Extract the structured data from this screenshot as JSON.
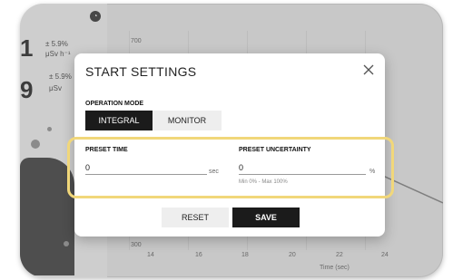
{
  "background": {
    "reading_1": {
      "value": "1",
      "percent": "± 5.9%",
      "unit": "μSv h⁻¹"
    },
    "reading_2": {
      "value": "9",
      "percent": "± 5.9%",
      "unit": "μSv"
    },
    "clock_icon_glyph": "◔",
    "chart": {
      "y_ticks": [
        "700",
        "300"
      ],
      "x_ticks": [
        "14",
        "16",
        "18",
        "20",
        "22",
        "24"
      ],
      "x_label": "Time (sec)"
    }
  },
  "modal": {
    "title": "START SETTINGS",
    "operation_mode": {
      "label": "OPERATION MODE",
      "options": [
        "INTEGRAL",
        "MONITOR"
      ],
      "selected": "INTEGRAL"
    },
    "preset_time": {
      "label": "PRESET TIME",
      "value": "0",
      "unit": "sec"
    },
    "preset_uncertainty": {
      "label": "PRESET UNCERTAINTY",
      "value": "0",
      "unit": "%",
      "hint": "Min 0% - Max 100%"
    },
    "reset_label": "RESET",
    "save_label": "SAVE"
  },
  "colors": {
    "highlight": "#f1d77a",
    "primary_button": "#1b1b1b",
    "secondary_button": "#eeeeee"
  }
}
